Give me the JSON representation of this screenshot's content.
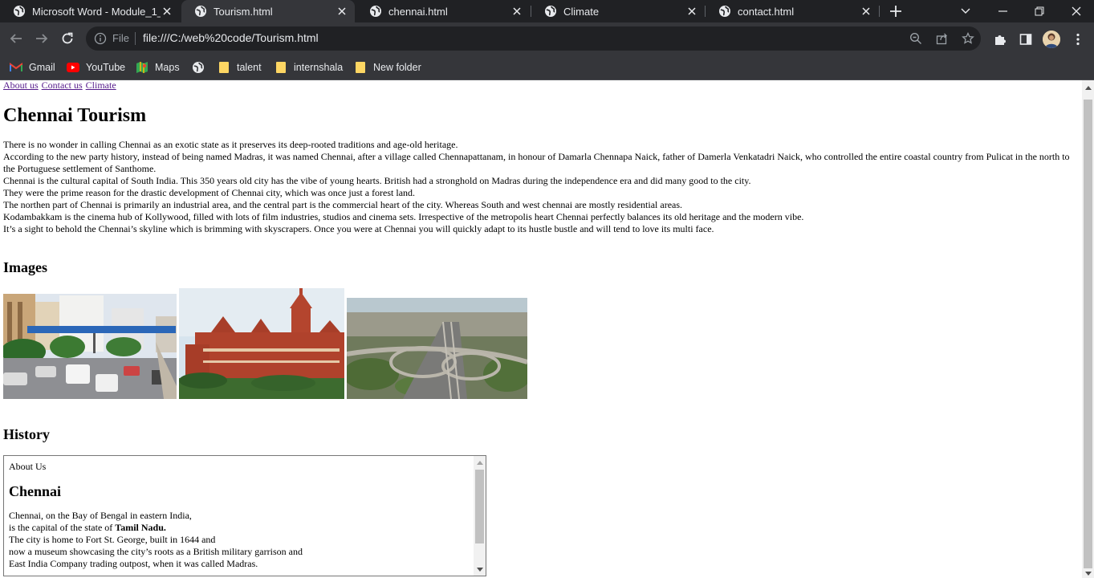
{
  "browser": {
    "tabs": [
      {
        "title": "Microsoft Word - Module_1_",
        "active": false
      },
      {
        "title": "Tourism.html",
        "active": true
      },
      {
        "title": "chennai.html",
        "active": false
      },
      {
        "title": "Climate",
        "active": false
      },
      {
        "title": "contact.html",
        "active": false
      }
    ],
    "omnibox": {
      "scheme_label": "File",
      "url": "file:///C:/web%20code/Tourism.html"
    },
    "bookmarks": [
      {
        "label": "Gmail",
        "icon": "gmail-icon"
      },
      {
        "label": "YouTube",
        "icon": "youtube-icon"
      },
      {
        "label": "Maps",
        "icon": "maps-icon"
      },
      {
        "label": "",
        "icon": "globe-icon"
      },
      {
        "label": "talent",
        "icon": "folder-icon"
      },
      {
        "label": "internshala",
        "icon": "folder-icon"
      },
      {
        "label": "New folder",
        "icon": "folder-icon"
      }
    ],
    "colors": {
      "tabstrip": "#202124",
      "toolbar": "#35363a",
      "text": "#e8eaed",
      "link": "#551a8b"
    }
  },
  "page": {
    "nav_links": [
      "About us",
      "Contact us",
      "Climate"
    ],
    "title": "Chennai Tourism",
    "intro_lines": [
      "There is no wonder in calling Chennai as an exotic state as it preserves its deep-rooted traditions and age-old heritage.",
      "According to the new party history, instead of being named Madras, it was named Chennai, after a village called Chennapattanam, in honour of Damarla Chennapa Naick, father of Damerla Venkatadri Naick, who controlled the entire coastal country from Pulicat in the north to the Portuguese settlement of Santhome.",
      "Chennai is the cultural capital of South India. This 350 years old city has the vibe of young hearts. British had a stronghold on Madras during the independence era and did many good to the city.",
      "They were the prime reason for the drastic development of Chennai city, which was once just a forest land.",
      "The northen part of Chennai is primarily an industrial area, and the central part is the commercial heart of the city. Whereas South and west chennai are mostly residential areas.",
      "Kodambakkam is the cinema hub of Kollywood, filled with lots of film industries, studios and cinema sets. Irrespective of the metropolis heart Chennai perfectly balances its old heritage and the modern vibe.",
      "It’s a sight to behold the Chennai’s skyline which is brimming with skyscrapers. Once you were at Chennai you will quickly adapt to its hustle bustle and will tend to love its multi face."
    ],
    "images_heading": "Images",
    "history_heading": "History",
    "history_frame": {
      "about": "About Us",
      "heading": "Chennai",
      "lines": [
        {
          "text": "Chennai, on the Bay of Bengal in eastern India,"
        },
        {
          "text": "is the capital of the state of ",
          "bold": "Tamil Nadu."
        },
        {
          "text": "The city is home to Fort St. George, built in 1644 and"
        },
        {
          "text": "now a museum showcasing the city’s roots as a British military garrison and"
        },
        {
          "text": "East India Company trading outpost, when it was called Madras."
        }
      ]
    }
  }
}
